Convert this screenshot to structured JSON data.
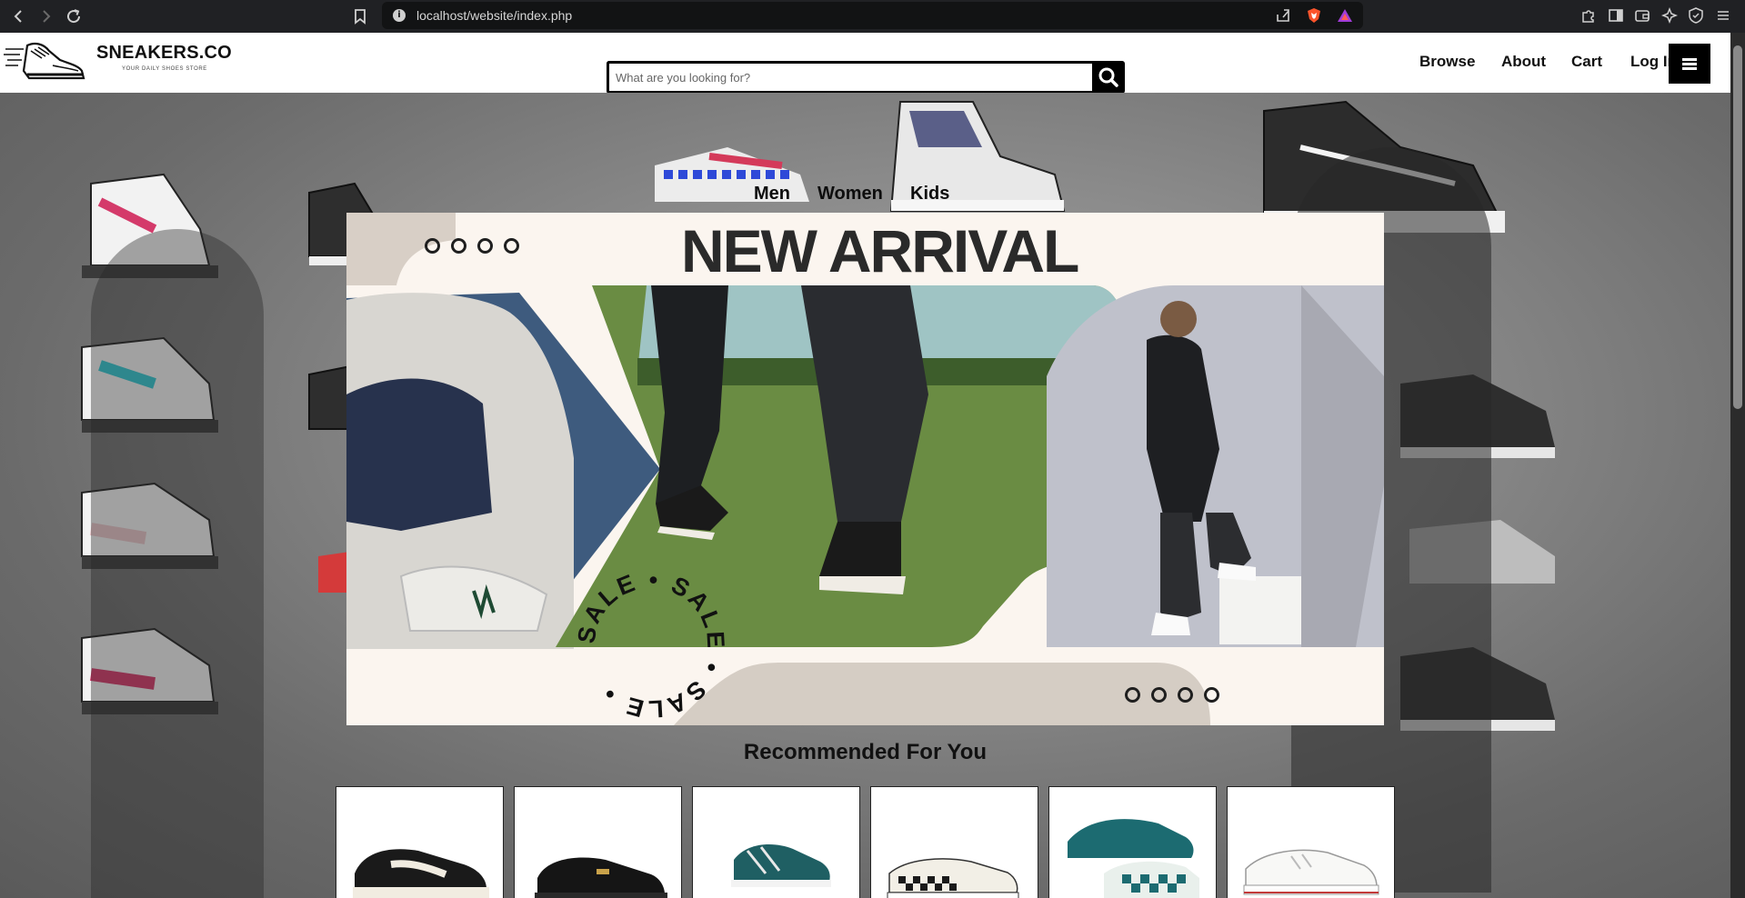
{
  "browser": {
    "url": "localhost/website/index.php"
  },
  "site": {
    "brand": "SNEAKERS.CO",
    "tagline": "YOUR DAILY SHOES STORE",
    "search_placeholder": "What are you looking for?",
    "menu": [
      "Browse",
      "About",
      "Cart",
      "Log In"
    ]
  },
  "hero": {
    "categories": [
      "Men",
      "Women",
      "Kids"
    ],
    "banner_title": "NEW ARRIVAL",
    "sale_text": "SALE • SALE • SALE •"
  },
  "recommended": {
    "title": "Recommended For You",
    "products": [
      {
        "icon": "black-white-sneaker-icon"
      },
      {
        "icon": "black-suede-sneaker-icon"
      },
      {
        "icon": "teal-sneaker-icon"
      },
      {
        "icon": "checkerboard-slip-on-icon"
      },
      {
        "icon": "teal-checkerboard-slip-on-icon"
      },
      {
        "icon": "white-canvas-sneaker-icon"
      }
    ]
  },
  "colors": {
    "chrome": "#202124",
    "banner": "#fbf5ef",
    "accent": "#000000"
  }
}
